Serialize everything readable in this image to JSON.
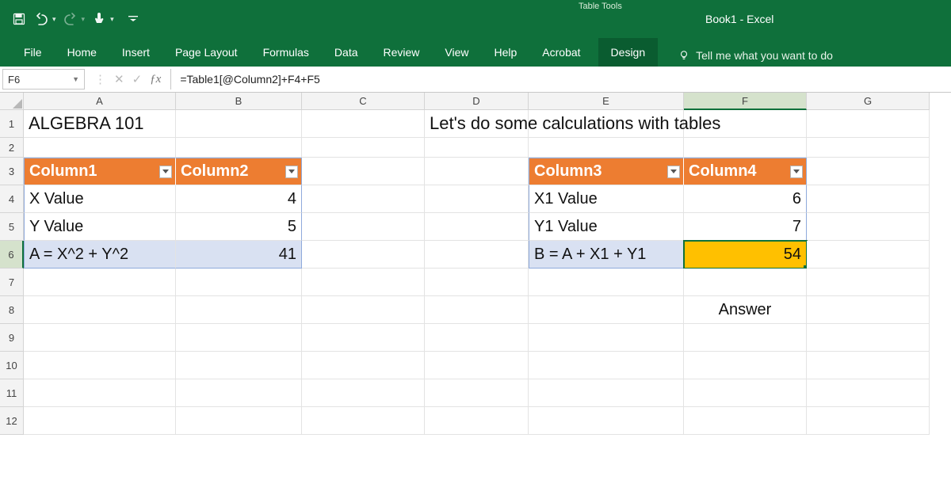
{
  "titlebar": {
    "table_tools": "Table Tools",
    "doc_title": "Book1  -  Excel"
  },
  "ribbon": {
    "tabs": [
      "File",
      "Home",
      "Insert",
      "Page Layout",
      "Formulas",
      "Data",
      "Review",
      "View",
      "Help",
      "Acrobat"
    ],
    "context_tab": "Design",
    "tell_me": "Tell me what you want to do"
  },
  "formula_bar": {
    "name_box": "F6",
    "formula": "=Table1[@Column2]+F4+F5"
  },
  "columns": [
    "A",
    "B",
    "C",
    "D",
    "E",
    "F",
    "G"
  ],
  "active_col_index": 5,
  "row_labels": [
    "1",
    "2",
    "3",
    "4",
    "5",
    "6",
    "7",
    "8",
    "9",
    "10",
    "11",
    "12"
  ],
  "active_row_index": 5,
  "sheet": {
    "A1": "ALGEBRA 101",
    "D1": "Let's do some calculations with tables",
    "table1_headers": [
      "Column1",
      "Column2"
    ],
    "table1_rows": [
      {
        "label": "X Value",
        "value": "4"
      },
      {
        "label": "Y Value",
        "value": "5"
      },
      {
        "label": "A = X^2 + Y^2",
        "value": "41"
      }
    ],
    "table2_headers": [
      "Column3",
      "Column4"
    ],
    "table2_rows": [
      {
        "label": "X1 Value",
        "value": "6"
      },
      {
        "label": "Y1 Value",
        "value": "7"
      },
      {
        "label": "B = A + X1 + Y1",
        "value": "54"
      }
    ],
    "F8": "Answer"
  }
}
